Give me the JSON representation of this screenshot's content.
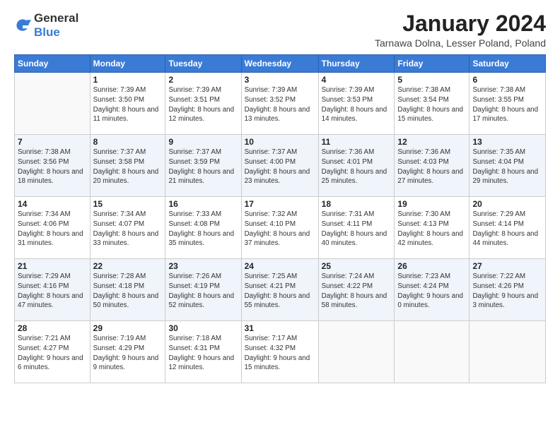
{
  "header": {
    "logo_general": "General",
    "logo_blue": "Blue",
    "month_title": "January 2024",
    "location": "Tarnawa Dolna, Lesser Poland, Poland"
  },
  "weekdays": [
    "Sunday",
    "Monday",
    "Tuesday",
    "Wednesday",
    "Thursday",
    "Friday",
    "Saturday"
  ],
  "weeks": [
    [
      {
        "day": "",
        "empty": true
      },
      {
        "day": "1",
        "sunrise": "7:39 AM",
        "sunset": "3:50 PM",
        "daylight": "8 hours and 11 minutes."
      },
      {
        "day": "2",
        "sunrise": "7:39 AM",
        "sunset": "3:51 PM",
        "daylight": "8 hours and 12 minutes."
      },
      {
        "day": "3",
        "sunrise": "7:39 AM",
        "sunset": "3:52 PM",
        "daylight": "8 hours and 13 minutes."
      },
      {
        "day": "4",
        "sunrise": "7:39 AM",
        "sunset": "3:53 PM",
        "daylight": "8 hours and 14 minutes."
      },
      {
        "day": "5",
        "sunrise": "7:38 AM",
        "sunset": "3:54 PM",
        "daylight": "8 hours and 15 minutes."
      },
      {
        "day": "6",
        "sunrise": "7:38 AM",
        "sunset": "3:55 PM",
        "daylight": "8 hours and 17 minutes."
      }
    ],
    [
      {
        "day": "7",
        "sunrise": "7:38 AM",
        "sunset": "3:56 PM",
        "daylight": "8 hours and 18 minutes."
      },
      {
        "day": "8",
        "sunrise": "7:37 AM",
        "sunset": "3:58 PM",
        "daylight": "8 hours and 20 minutes."
      },
      {
        "day": "9",
        "sunrise": "7:37 AM",
        "sunset": "3:59 PM",
        "daylight": "8 hours and 21 minutes."
      },
      {
        "day": "10",
        "sunrise": "7:37 AM",
        "sunset": "4:00 PM",
        "daylight": "8 hours and 23 minutes."
      },
      {
        "day": "11",
        "sunrise": "7:36 AM",
        "sunset": "4:01 PM",
        "daylight": "8 hours and 25 minutes."
      },
      {
        "day": "12",
        "sunrise": "7:36 AM",
        "sunset": "4:03 PM",
        "daylight": "8 hours and 27 minutes."
      },
      {
        "day": "13",
        "sunrise": "7:35 AM",
        "sunset": "4:04 PM",
        "daylight": "8 hours and 29 minutes."
      }
    ],
    [
      {
        "day": "14",
        "sunrise": "7:34 AM",
        "sunset": "4:06 PM",
        "daylight": "8 hours and 31 minutes."
      },
      {
        "day": "15",
        "sunrise": "7:34 AM",
        "sunset": "4:07 PM",
        "daylight": "8 hours and 33 minutes."
      },
      {
        "day": "16",
        "sunrise": "7:33 AM",
        "sunset": "4:08 PM",
        "daylight": "8 hours and 35 minutes."
      },
      {
        "day": "17",
        "sunrise": "7:32 AM",
        "sunset": "4:10 PM",
        "daylight": "8 hours and 37 minutes."
      },
      {
        "day": "18",
        "sunrise": "7:31 AM",
        "sunset": "4:11 PM",
        "daylight": "8 hours and 40 minutes."
      },
      {
        "day": "19",
        "sunrise": "7:30 AM",
        "sunset": "4:13 PM",
        "daylight": "8 hours and 42 minutes."
      },
      {
        "day": "20",
        "sunrise": "7:29 AM",
        "sunset": "4:14 PM",
        "daylight": "8 hours and 44 minutes."
      }
    ],
    [
      {
        "day": "21",
        "sunrise": "7:29 AM",
        "sunset": "4:16 PM",
        "daylight": "8 hours and 47 minutes."
      },
      {
        "day": "22",
        "sunrise": "7:28 AM",
        "sunset": "4:18 PM",
        "daylight": "8 hours and 50 minutes."
      },
      {
        "day": "23",
        "sunrise": "7:26 AM",
        "sunset": "4:19 PM",
        "daylight": "8 hours and 52 minutes."
      },
      {
        "day": "24",
        "sunrise": "7:25 AM",
        "sunset": "4:21 PM",
        "daylight": "8 hours and 55 minutes."
      },
      {
        "day": "25",
        "sunrise": "7:24 AM",
        "sunset": "4:22 PM",
        "daylight": "8 hours and 58 minutes."
      },
      {
        "day": "26",
        "sunrise": "7:23 AM",
        "sunset": "4:24 PM",
        "daylight": "9 hours and 0 minutes."
      },
      {
        "day": "27",
        "sunrise": "7:22 AM",
        "sunset": "4:26 PM",
        "daylight": "9 hours and 3 minutes."
      }
    ],
    [
      {
        "day": "28",
        "sunrise": "7:21 AM",
        "sunset": "4:27 PM",
        "daylight": "9 hours and 6 minutes."
      },
      {
        "day": "29",
        "sunrise": "7:19 AM",
        "sunset": "4:29 PM",
        "daylight": "9 hours and 9 minutes."
      },
      {
        "day": "30",
        "sunrise": "7:18 AM",
        "sunset": "4:31 PM",
        "daylight": "9 hours and 12 minutes."
      },
      {
        "day": "31",
        "sunrise": "7:17 AM",
        "sunset": "4:32 PM",
        "daylight": "9 hours and 15 minutes."
      },
      {
        "day": "",
        "empty": true
      },
      {
        "day": "",
        "empty": true
      },
      {
        "day": "",
        "empty": true
      }
    ]
  ]
}
